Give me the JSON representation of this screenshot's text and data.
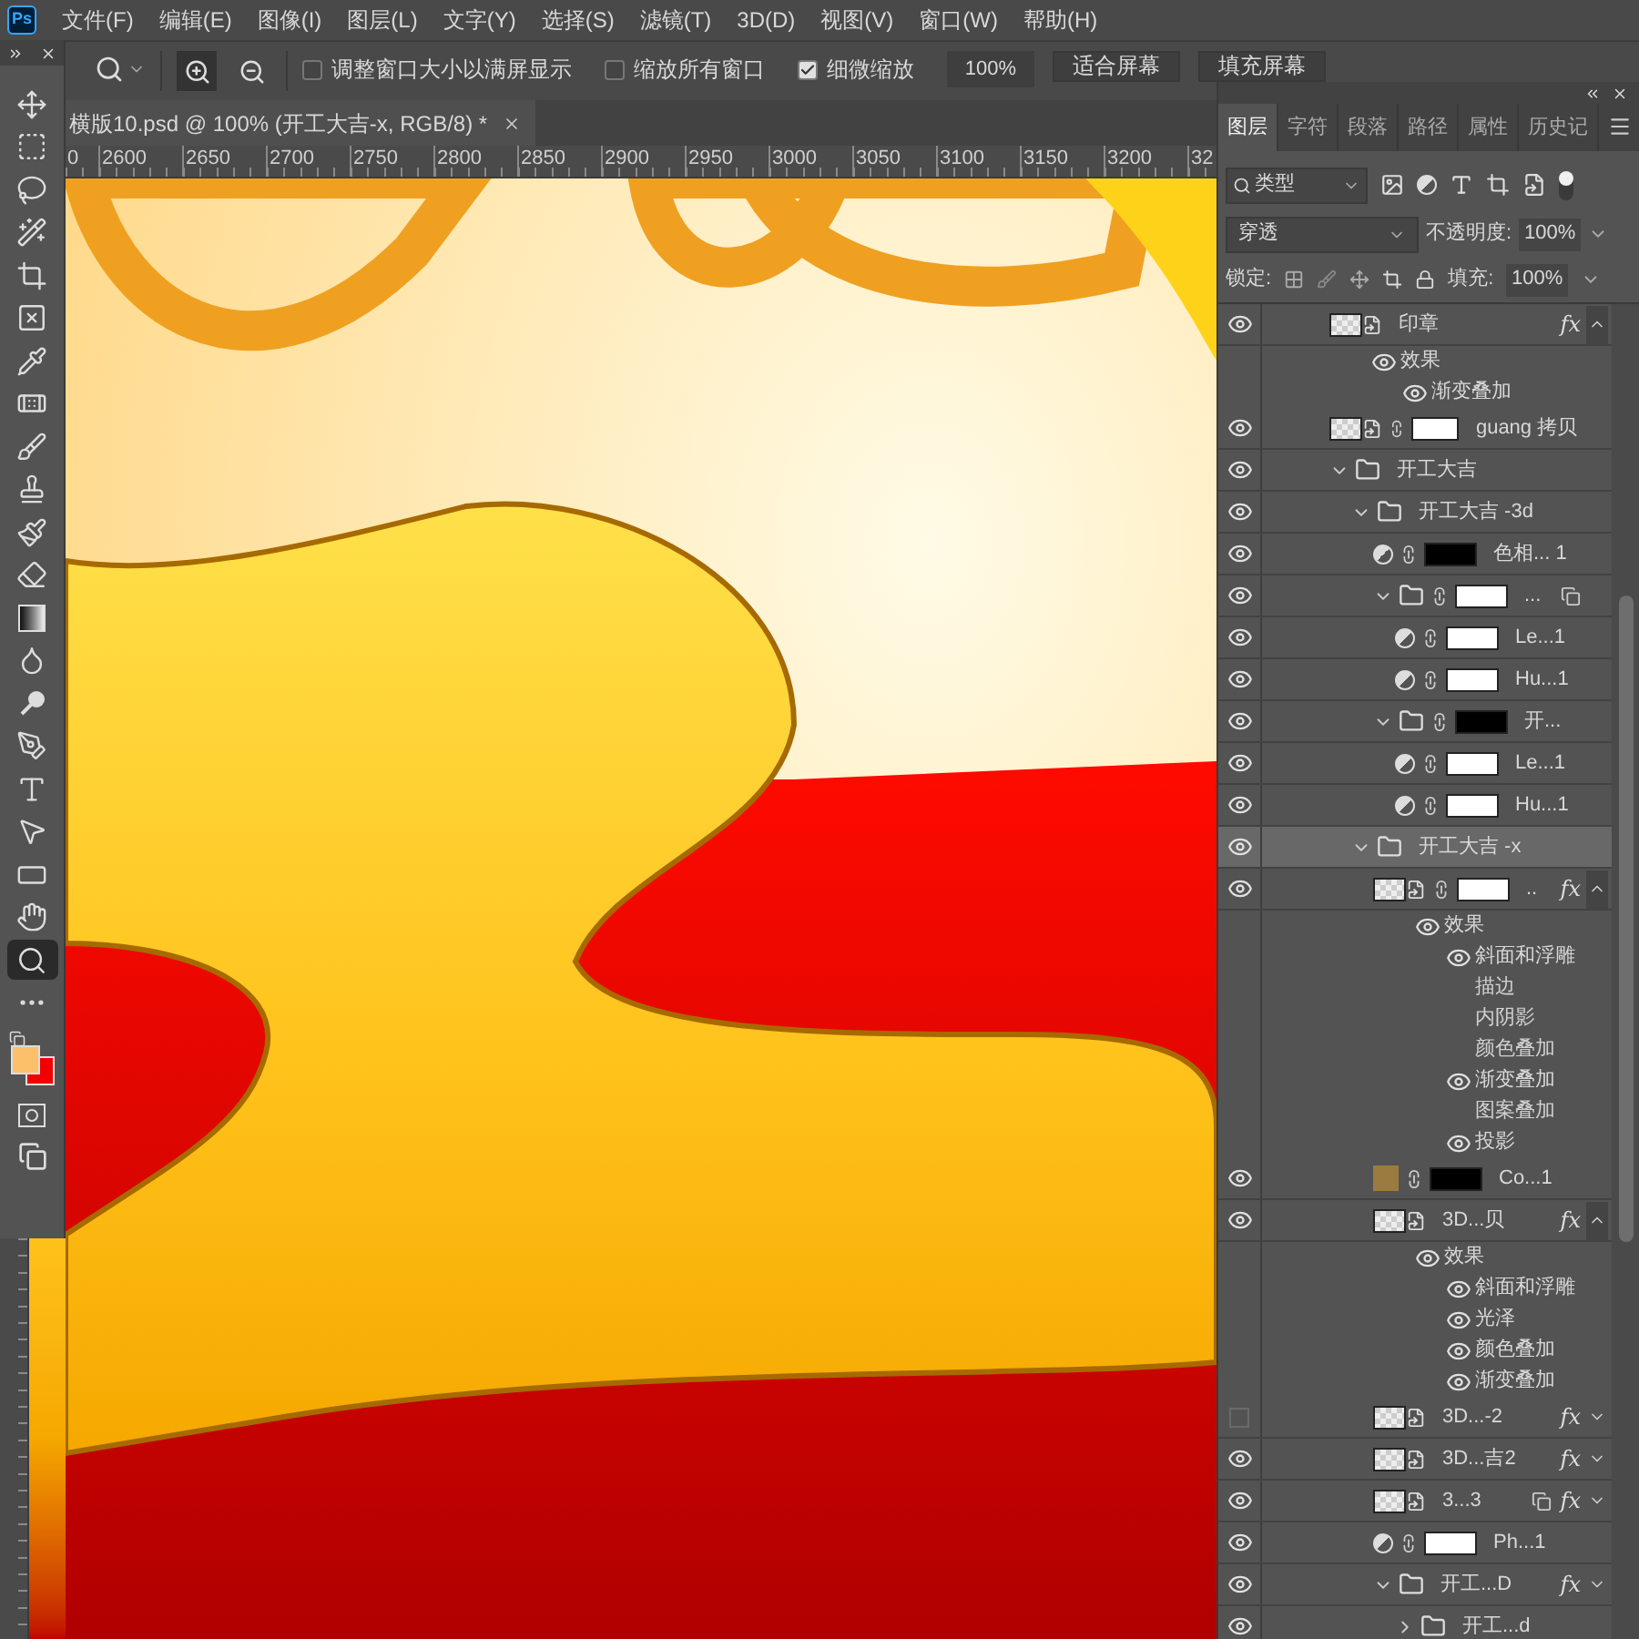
{
  "app_icon_label": "Ps",
  "menu": [
    "文件(F)",
    "编辑(E)",
    "图像(I)",
    "图层(L)",
    "文字(Y)",
    "选择(S)",
    "滤镜(T)",
    "3D(D)",
    "视图(V)",
    "窗口(W)",
    "帮助(H)"
  ],
  "options_bar": {
    "zoom_in_selected": true,
    "zoom_out_selected": false,
    "checkboxes": [
      {
        "label": "调整窗口大小以满屏显示",
        "checked": false
      },
      {
        "label": "缩放所有窗口",
        "checked": false
      },
      {
        "label": "细微缩放",
        "checked": true
      }
    ],
    "zoom_value": "100%",
    "buttons": [
      "适合屏幕",
      "填充屏幕"
    ]
  },
  "toolbar": {
    "tools": [
      {
        "kind": "move",
        "selected": false
      },
      {
        "kind": "marquee",
        "selected": false
      },
      {
        "kind": "lasso",
        "selected": false
      },
      {
        "kind": "wand",
        "selected": false
      },
      {
        "kind": "crop",
        "selected": false
      },
      {
        "kind": "frame",
        "selected": false
      },
      {
        "kind": "eyedropper",
        "selected": false
      },
      {
        "kind": "healing",
        "selected": false
      },
      {
        "kind": "brush",
        "selected": false
      },
      {
        "kind": "stamp",
        "selected": false
      },
      {
        "kind": "history",
        "selected": false
      },
      {
        "kind": "eraser",
        "selected": false
      },
      {
        "kind": "gradient",
        "selected": false
      },
      {
        "kind": "smudge",
        "selected": false
      },
      {
        "kind": "dodge",
        "selected": false
      },
      {
        "kind": "pen",
        "selected": false
      },
      {
        "kind": "type",
        "selected": false
      },
      {
        "kind": "path",
        "selected": false
      },
      {
        "kind": "rectangle",
        "selected": false
      },
      {
        "kind": "hand",
        "selected": false
      },
      {
        "kind": "zoom",
        "selected": true
      },
      {
        "kind": "more",
        "selected": false
      }
    ],
    "swatches": [
      {
        "kind": "foreground",
        "color": "#fcc06a"
      },
      {
        "kind": "background",
        "color": "#f20000"
      }
    ]
  },
  "document_tab": {
    "title": "横版10.psd @ 100% (开工大吉-x, RGB/8) *"
  },
  "ruler": [
    "0",
    "2600",
    "2650",
    "2700",
    "2750",
    "2800",
    "2850",
    "2900",
    "2950",
    "3000",
    "3050",
    "3100",
    "3150",
    "3200",
    "32"
  ],
  "layers_panel": {
    "tabs": [
      {
        "label": "图层",
        "selected": true
      },
      {
        "label": "字符",
        "selected": false
      },
      {
        "label": "段落",
        "selected": false
      },
      {
        "label": "路径",
        "selected": false
      },
      {
        "label": "属性",
        "selected": false
      },
      {
        "label": "历史记",
        "selected": false
      }
    ],
    "filter": {
      "value": "类型",
      "on": true
    },
    "blend_mode": "穿透",
    "opacity_label": "不透明度:",
    "opacity": "100%",
    "lock_label": "锁定:",
    "fill_label": "填充:",
    "fill": "100%",
    "layers": [
      {
        "kind": "layer",
        "name": "印章",
        "visible": true,
        "selected": false,
        "smart": true,
        "fx_label": "fx",
        "fx_expanded": true,
        "effects": {
          "name": "效果",
          "visible": true,
          "items": [
            {
              "name": "渐变叠加",
              "visible": true
            }
          ]
        }
      },
      {
        "kind": "layer",
        "name": "guang 拷贝",
        "visible": true,
        "selected": false,
        "smart": true,
        "mask": {
          "color": "#ffffff"
        }
      },
      {
        "kind": "folder",
        "name": "开工大吉",
        "visible": true,
        "selected": false,
        "expanded": true,
        "children": [
          {
            "kind": "folder",
            "name": "开工大吉 -3d",
            "visible": true,
            "selected": false,
            "expanded": true,
            "children": [
              {
                "kind": "adjustment",
                "name": "色相... 1",
                "visible": true,
                "selected": false,
                "mask": {
                  "color": "#000000"
                }
              },
              {
                "kind": "folder",
                "name": "...",
                "visible": true,
                "selected": false,
                "expanded": true,
                "mask": {
                  "color": "#ffffff"
                },
                "clip": true,
                "children": [
                  {
                    "kind": "adjustment",
                    "name": "Le...1",
                    "visible": true,
                    "selected": false,
                    "mask": {
                      "color": "#ffffff"
                    }
                  },
                  {
                    "kind": "adjustment",
                    "name": "Hu...1",
                    "visible": true,
                    "selected": false,
                    "mask": {
                      "color": "#ffffff"
                    }
                  }
                ]
              },
              {
                "kind": "folder",
                "name": "开...",
                "visible": true,
                "selected": false,
                "expanded": true,
                "mask": {
                  "color": "#000000"
                },
                "children": [
                  {
                    "kind": "adjustment",
                    "name": "Le...1",
                    "visible": true,
                    "selected": false,
                    "mask": {
                      "color": "#ffffff"
                    }
                  },
                  {
                    "kind": "adjustment",
                    "name": "Hu...1",
                    "visible": true,
                    "selected": false,
                    "mask": {
                      "color": "#ffffff"
                    }
                  }
                ]
              }
            ]
          },
          {
            "kind": "folder",
            "name": "开工大吉 -x",
            "visible": true,
            "selected": true,
            "expanded": true,
            "children": [
              {
                "kind": "layer",
                "name": "..",
                "visible": true,
                "selected": false,
                "smart": true,
                "mask": {
                  "color": "#ffffff"
                },
                "fx_label": "fx",
                "fx_expanded": true,
                "effects": {
                  "name": "效果",
                  "visible": true,
                  "items": [
                    {
                      "name": "斜面和浮雕",
                      "visible": true
                    },
                    {
                      "name": "描边",
                      "visible": false
                    },
                    {
                      "name": "内阴影",
                      "visible": false
                    },
                    {
                      "name": "颜色叠加",
                      "visible": false
                    },
                    {
                      "name": "渐变叠加",
                      "visible": true
                    },
                    {
                      "name": "图案叠加",
                      "visible": false
                    },
                    {
                      "name": "投影",
                      "visible": true
                    }
                  ]
                }
              },
              {
                "kind": "fill",
                "name": "Co...1",
                "visible": true,
                "selected": false,
                "color": "#9c7b40",
                "mask": {
                  "color": "#000000"
                }
              },
              {
                "kind": "layer",
                "name": "3D...贝",
                "visible": true,
                "selected": false,
                "smart": true,
                "fx_label": "fx",
                "fx_expanded": true,
                "effects": {
                  "name": "效果",
                  "visible": true,
                  "items": [
                    {
                      "name": "斜面和浮雕",
                      "visible": true
                    },
                    {
                      "name": "光泽",
                      "visible": true
                    },
                    {
                      "name": "颜色叠加",
                      "visible": true
                    },
                    {
                      "name": "渐变叠加",
                      "visible": true
                    }
                  ]
                }
              },
              {
                "kind": "layer",
                "name": "3D...-2",
                "visible": false,
                "selected": false,
                "smart": true,
                "fx_label": "fx",
                "fx_expanded": false
              },
              {
                "kind": "layer",
                "name": "3D...吉2",
                "visible": true,
                "selected": false,
                "smart": true,
                "fx_label": "fx",
                "fx_expanded": false
              },
              {
                "kind": "layer",
                "name": "3...3",
                "visible": true,
                "selected": false,
                "smart": true,
                "clip": true,
                "fx_label": "fx",
                "fx_expanded": false
              },
              {
                "kind": "adjustment",
                "name": "Ph...1",
                "visible": true,
                "selected": false,
                "mask": {
                  "color": "#ffffff"
                }
              },
              {
                "kind": "folder",
                "name": "开工...D",
                "visible": true,
                "selected": false,
                "expanded": true,
                "fx_label": "fx",
                "fx_expanded": false,
                "children": [
                  {
                    "kind": "folder",
                    "name": "开工...d",
                    "visible": true,
                    "selected": false,
                    "expanded": false
                  }
                ]
              }
            ]
          }
        ]
      }
    ]
  }
}
